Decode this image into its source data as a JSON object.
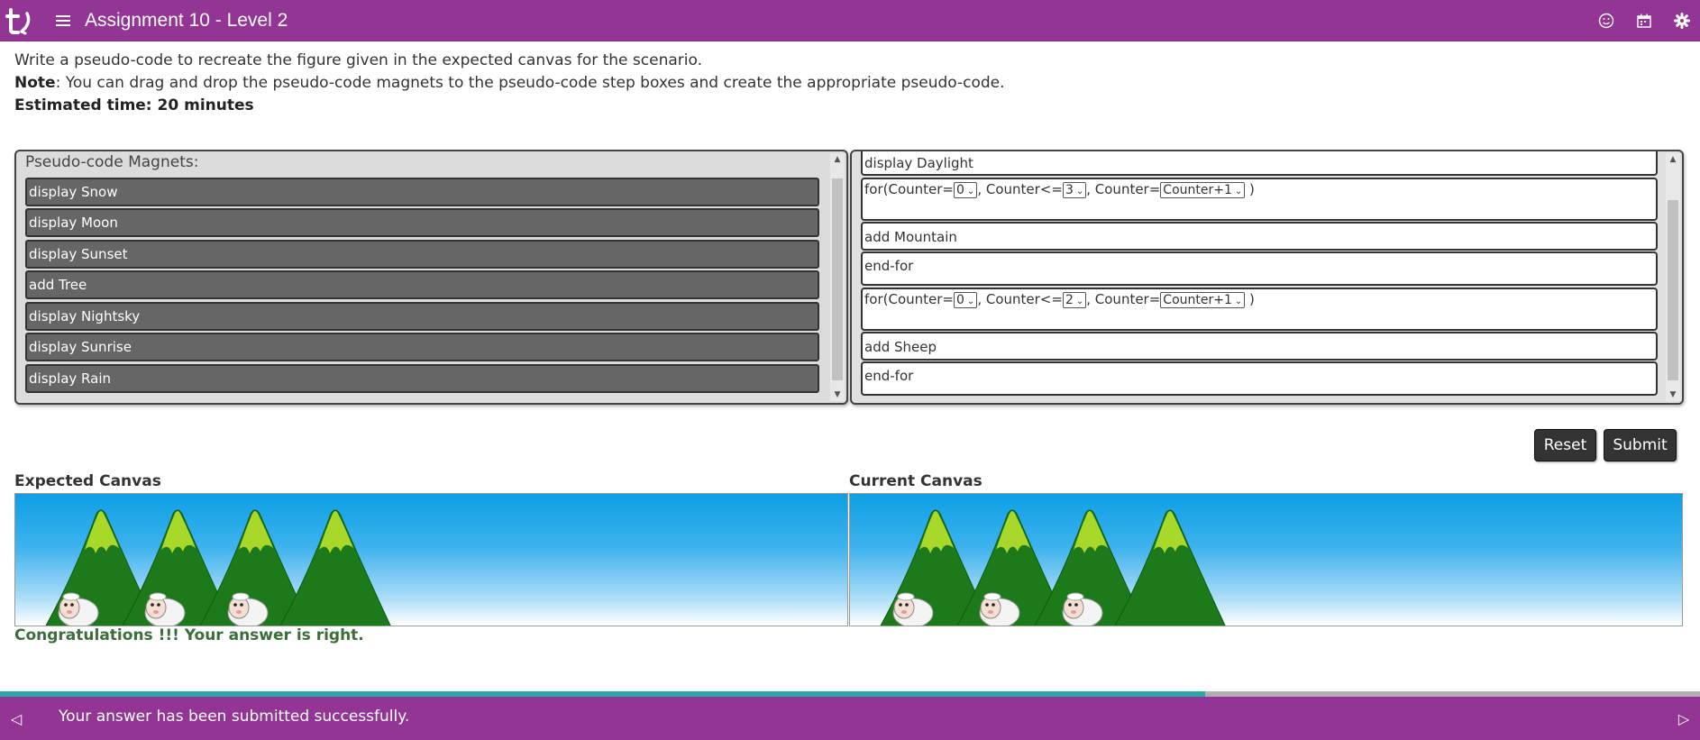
{
  "header": {
    "title": "Assignment 10 - Level 2",
    "icons": [
      "logo-icon",
      "menu-icon",
      "smiley-icon",
      "calendar-icon",
      "settings-gear-icon"
    ],
    "color": "#933594"
  },
  "instructions": {
    "line1": "Write a pseudo-code to recreate the figure given in the expected canvas for the scenario.",
    "note_label": "Note",
    "note_text": ": You can drag and drop the pseudo-code magnets to the pseudo-code step boxes and create the appropriate pseudo-code.",
    "estimated": "Estimated time: 20 minutes"
  },
  "magnets": {
    "title": "Pseudo-code Magnets:",
    "items": [
      "display Snow",
      "display Moon",
      "display Sunset",
      "add Tree",
      "display Nightsky",
      "display Sunrise",
      "display Rain"
    ]
  },
  "steps": {
    "step1": "display Daylight",
    "loop1": {
      "prefix": "for(Counter=",
      "start": "0",
      "mid": ", Counter<=",
      "end": "3",
      "mid2": ", Counter=",
      "incr": "Counter+1",
      "suffix": " )"
    },
    "step3": "add Mountain",
    "step4": "end-for",
    "loop2": {
      "prefix": "for(Counter=",
      "start": "0",
      "mid": ", Counter<=",
      "end": "2",
      "mid2": ", Counter=",
      "incr": "Counter+1",
      "suffix": " )"
    },
    "step6": "add Sheep",
    "step7": "end-for"
  },
  "buttons": {
    "reset": "Reset",
    "submit": "Submit"
  },
  "canvases": {
    "expected_label": "Expected Canvas",
    "current_label": "Current Canvas",
    "expected": {
      "mountains": 4,
      "sheep": 3
    },
    "current": {
      "mountains": 4,
      "sheep": 3
    }
  },
  "result": {
    "message": "Congratulations !!! Your answer is right."
  },
  "progress": {
    "fraction": 0.709,
    "fill_color": "#2aa8a8"
  },
  "footer": {
    "message": "Your answer has been submitted successfully."
  }
}
